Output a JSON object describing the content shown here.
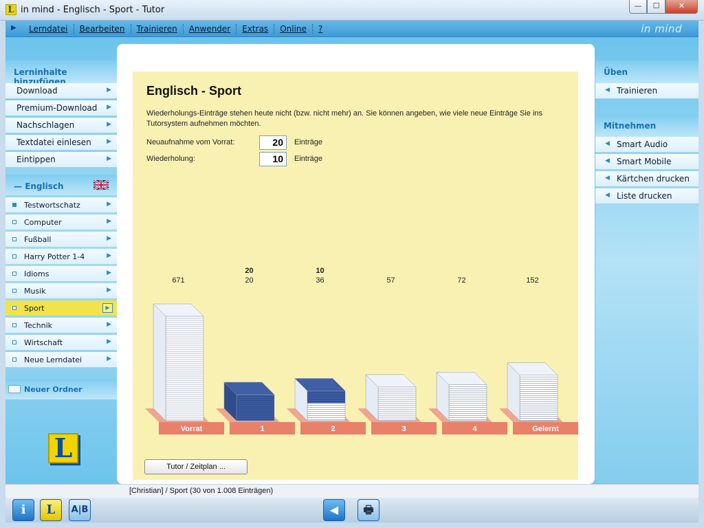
{
  "window": {
    "title": "in mind - Englisch - Sport - Tutor",
    "logo_letter": "L",
    "min": "—",
    "max": "☐",
    "close": "✕"
  },
  "menu": {
    "items": [
      "Lerndatei",
      "Bearbeiten",
      "Trainieren",
      "Anwender",
      "Extras",
      "Online",
      "?"
    ],
    "brand": "in mind"
  },
  "left": {
    "section_title": "Lerninhalte hinzufügen",
    "items": [
      "Download",
      "Premium-Download",
      "Nachschlagen",
      "Textdatei einlesen",
      "Eintippen"
    ],
    "language": "Englisch",
    "subitems": [
      "Testwortschatz",
      "Computer",
      "Fußball",
      "Harry Potter 1-4",
      "Idioms",
      "Musik",
      "Sport",
      "Technik",
      "Wirtschaft",
      "Neue Lerndatei"
    ],
    "active_subitem": 6,
    "folder": "Neuer Ordner"
  },
  "right": {
    "section1": "Üben",
    "items1": [
      "Trainieren"
    ],
    "section2": "Mitnehmen",
    "items2": [
      "Smart Audio",
      "Smart Mobile",
      "Kärtchen drucken",
      "Liste drucken"
    ]
  },
  "main": {
    "title": "Englisch - Sport",
    "info": "Wiederholungs-Einträge stehen heute nicht (bzw. nicht mehr) an. Sie können angeben, wie viele neue Einträge Sie ins Tutorsystem aufnehmen möchten.",
    "field1_label": "Neuaufnahme vom Vorrat:",
    "field1_value": "20",
    "field2_label": "Wiederholung:",
    "field2_value": "10",
    "unit": "Einträge",
    "button": "Tutor / Zeitplan ..."
  },
  "chart_data": {
    "type": "bar",
    "categories": [
      "Vorrat",
      "1",
      "2",
      "3",
      "4",
      "Gelernt"
    ],
    "values": [
      671,
      20,
      36,
      57,
      72,
      152
    ],
    "selected": [
      null,
      20,
      10,
      null,
      null,
      null
    ],
    "colors": {
      "paper": "#ffffff",
      "selected": "#3f5fa6",
      "base": "#e8806a"
    }
  },
  "status": {
    "text": "[Christian]    / Sport  (30 von 1.008 Einträgen)"
  },
  "toolbar": {
    "info": "i",
    "logo": "L",
    "ab": "A|B",
    "back": "◀",
    "print": "🖶"
  }
}
